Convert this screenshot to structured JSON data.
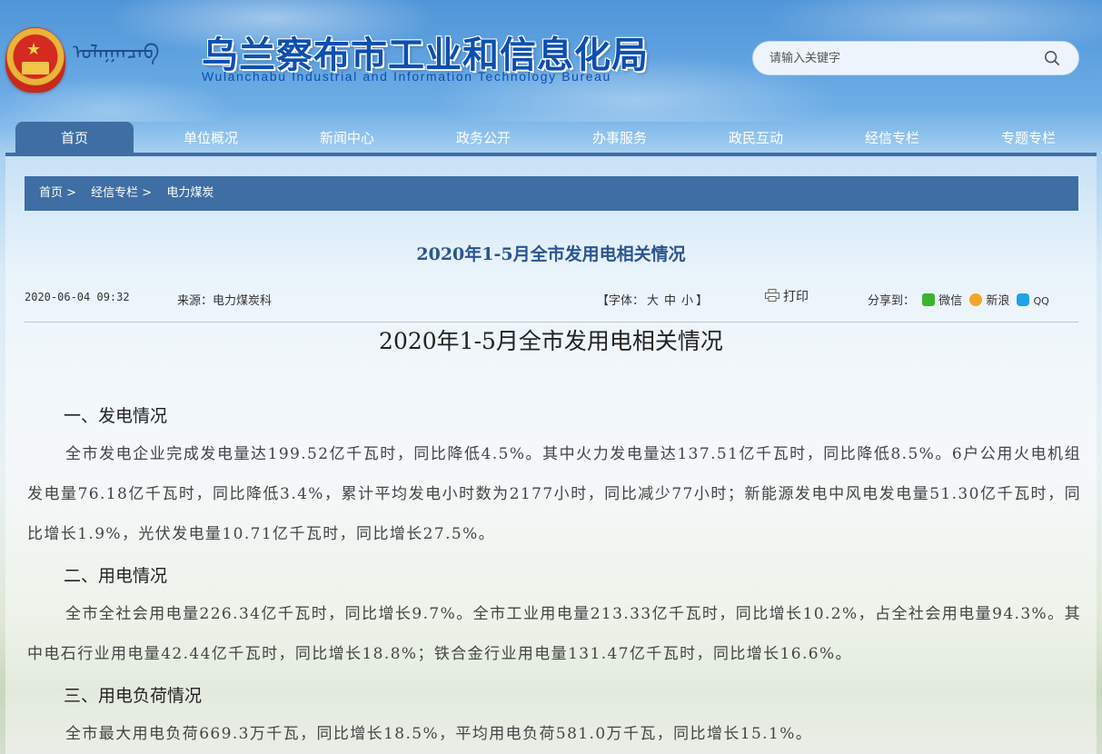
{
  "header": {
    "mongolian_text": "ᠤᠯᠠᠭᠠᠨᠴᠠᠪ",
    "title": "乌兰察布市工业和信息化局",
    "subtitle": "Wulanchabu Industrial and Information Technology Bureau",
    "search_placeholder": "请输入关键字"
  },
  "nav": {
    "items": [
      "首页",
      "单位概况",
      "新闻中心",
      "政务公开",
      "办事服务",
      "政民互动",
      "经信专栏",
      "专题专栏"
    ],
    "active": "首页"
  },
  "breadcrumb": [
    "首页 >",
    "经信专栏 >",
    "电力煤炭"
  ],
  "article": {
    "title": "2020年1-5月全市发用电相关情况",
    "date": "2020-06-04 09:32",
    "source": "来源：电力煤炭科",
    "fontsize_label": "【字体：",
    "fontsize_big": "大",
    "fontsize_mid": "中",
    "fontsize_small": "小",
    "fontsize_end": "】",
    "print_label": "打印",
    "share_label": "分享到：",
    "share_wechat": "微信",
    "share_weibo": "新浪",
    "share_qq": "QQ",
    "body_title": "2020年1-5月全市发用电相关情况",
    "sections": [
      {
        "heading": "一、发电情况",
        "text": "全市发电企业完成发电量达199.52亿千瓦时，同比降低4.5%。其中火力发电量达137.51亿千瓦时，同比降低8.5%。6户公用火电机组发电量76.18亿千瓦时，同比降低3.4%，累计平均发电小时数为2177小时，同比减少77小时；新能源发电中风电发电量51.30亿千瓦时，同比增长1.9%，光伏发电量10.71亿千瓦时，同比增长27.5%。"
      },
      {
        "heading": "二、用电情况",
        "text": "全市全社会用电量226.34亿千瓦时，同比增长9.7%。全市工业用电量213.33亿千瓦时，同比增长10.2%，占全社会用电量94.3%。其中电石行业用电量42.44亿千瓦时，同比增长18.8%；铁合金行业用电量131.47亿千瓦时，同比增长16.6%。"
      },
      {
        "heading": "三、用电负荷情况",
        "text": "全市最大用电负荷669.3万千瓦，同比增长18.5%，平均用电负荷581.0万千瓦，同比增长15.1%。"
      }
    ]
  }
}
